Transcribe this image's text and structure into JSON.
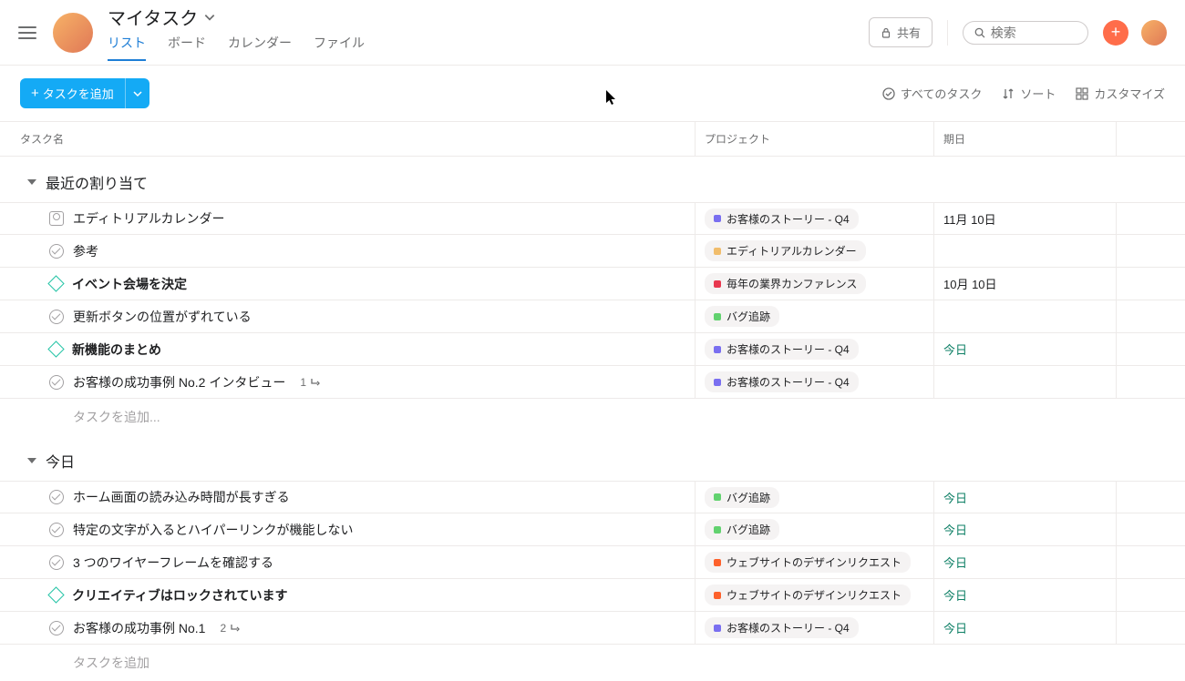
{
  "header": {
    "title": "マイタスク",
    "tabs": [
      "リスト",
      "ボード",
      "カレンダー",
      "ファイル"
    ],
    "share": "共有",
    "search_placeholder": "検索"
  },
  "toolbar": {
    "add_task": "タスクを追加",
    "all_tasks": "すべてのタスク",
    "sort": "ソート",
    "customize": "カスタマイズ"
  },
  "columns": {
    "name": "タスク名",
    "project": "プロジェクト",
    "due": "期日"
  },
  "sections": [
    {
      "title": "最近の割り当て",
      "tasks": [
        {
          "icon": "user",
          "name": "エディトリアルカレンダー",
          "bold": false,
          "project": {
            "label": "お客様のストーリー - Q4",
            "color": "#7a6ff0"
          },
          "due": "11月 10日",
          "due_today": false
        },
        {
          "icon": "check",
          "name": "参考",
          "bold": false,
          "project": {
            "label": "エディトリアルカレンダー",
            "color": "#f1bd6c"
          },
          "due": "",
          "due_today": false
        },
        {
          "icon": "diamond",
          "name": "イベント会場を決定",
          "bold": true,
          "project": {
            "label": "毎年の業界カンファレンス",
            "color": "#e8384f"
          },
          "due": "10月 10日",
          "due_today": false
        },
        {
          "icon": "check",
          "name": "更新ボタンの位置がずれている",
          "bold": false,
          "project": {
            "label": "バグ追跡",
            "color": "#62d26f"
          },
          "due": "",
          "due_today": false
        },
        {
          "icon": "diamond",
          "name": "新機能のまとめ",
          "bold": true,
          "project": {
            "label": "お客様のストーリー - Q4",
            "color": "#7a6ff0"
          },
          "due": "今日",
          "due_today": true
        },
        {
          "icon": "check",
          "name": "お客様の成功事例 No.2 インタビュー",
          "bold": false,
          "subtasks": "1",
          "project": {
            "label": "お客様のストーリー - Q4",
            "color": "#7a6ff0"
          },
          "due": "",
          "due_today": false
        }
      ],
      "add_placeholder": "タスクを追加..."
    },
    {
      "title": "今日",
      "tasks": [
        {
          "icon": "check",
          "name": "ホーム画面の読み込み時間が長すぎる",
          "bold": false,
          "project": {
            "label": "バグ追跡",
            "color": "#62d26f"
          },
          "due": "今日",
          "due_today": true
        },
        {
          "icon": "check",
          "name": "特定の文字が入るとハイパーリンクが機能しない",
          "bold": false,
          "project": {
            "label": "バグ追跡",
            "color": "#62d26f"
          },
          "due": "今日",
          "due_today": true
        },
        {
          "icon": "check",
          "name": "3 つのワイヤーフレームを確認する",
          "bold": false,
          "project": {
            "label": "ウェブサイトのデザインリクエスト",
            "color": "#fd612c"
          },
          "due": "今日",
          "due_today": true
        },
        {
          "icon": "diamond",
          "name": "クリエイティブはロックされています",
          "bold": true,
          "project": {
            "label": "ウェブサイトのデザインリクエスト",
            "color": "#fd612c"
          },
          "due": "今日",
          "due_today": true
        },
        {
          "icon": "check",
          "name": "お客様の成功事例 No.1",
          "bold": false,
          "subtasks": "2",
          "project": {
            "label": "お客様のストーリー - Q4",
            "color": "#7a6ff0"
          },
          "due": "今日",
          "due_today": true
        }
      ],
      "add_placeholder": "タスクを追加"
    }
  ]
}
